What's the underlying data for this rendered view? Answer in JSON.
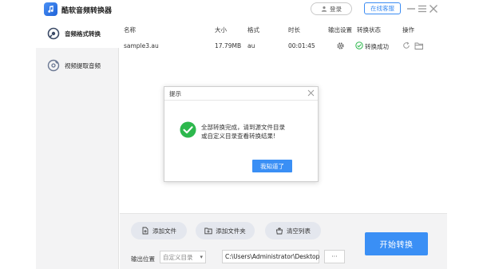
{
  "app": {
    "title": "酷软音频转换器"
  },
  "header": {
    "login_label": "登录",
    "service_label": "在线客服"
  },
  "sidebar": {
    "items": [
      {
        "label": "音频格式转换",
        "active": true
      },
      {
        "label": "视频提取音频",
        "active": false
      }
    ]
  },
  "table": {
    "headers": {
      "name": "名称",
      "size": "大小",
      "format": "格式",
      "duration": "时长",
      "output_settings": "输出设置",
      "status": "转换状态",
      "action": "操作"
    },
    "rows": [
      {
        "name": "sample3.au",
        "size": "17.79MB",
        "format": "au",
        "duration": "00:01:45",
        "status": "转换成功"
      }
    ]
  },
  "toolbar": {
    "add_file_label": "添加文件",
    "add_folder_label": "添加文件夹",
    "clear_list_label": "清空列表",
    "start_label": "开始转换"
  },
  "output": {
    "label": "输出位置",
    "mode_selected": "自定义目录",
    "path": "C:\\Users\\Administrator\\Desktop",
    "browse_label": "···"
  },
  "dialog": {
    "title": "提示",
    "message_line1": "全部转换完成，请到源文件目录",
    "message_line2": "或自定义目录查看转换结果!",
    "ok_label": "我知道了"
  },
  "colors": {
    "accent": "#3a8ff5",
    "success": "#2db84d",
    "sidebar_bg": "#f3f3f4"
  }
}
